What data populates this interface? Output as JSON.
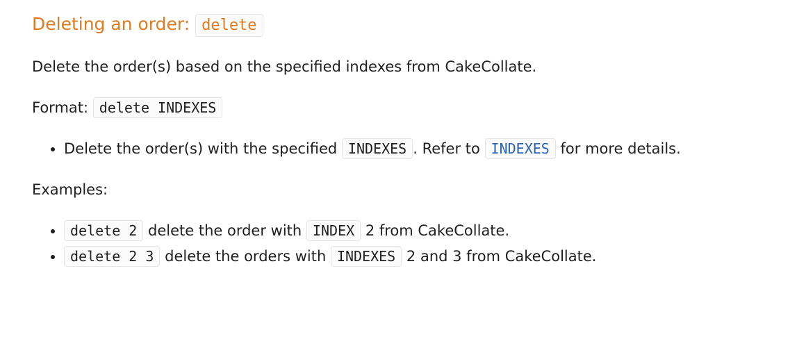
{
  "heading": {
    "text": "Deleting an order:",
    "command": "delete"
  },
  "description": "Delete the order(s) based on the specified indexes from CakeCollate.",
  "format": {
    "label": "Format:",
    "syntax": "delete INDEXES"
  },
  "notes": [
    {
      "pre": "Delete the order(s) with the specified",
      "code": "INDEXES",
      "mid": ". Refer to",
      "link": "INDEXES",
      "post": "for more details."
    }
  ],
  "examples_label": "Examples:",
  "examples": [
    {
      "command": "delete 2",
      "pre": "delete the order with",
      "code": "INDEX",
      "post": "2 from CakeCollate."
    },
    {
      "command": "delete 2 3",
      "pre": "delete the orders with",
      "code": "INDEXES",
      "post": "2 and 3 from CakeCollate."
    }
  ]
}
